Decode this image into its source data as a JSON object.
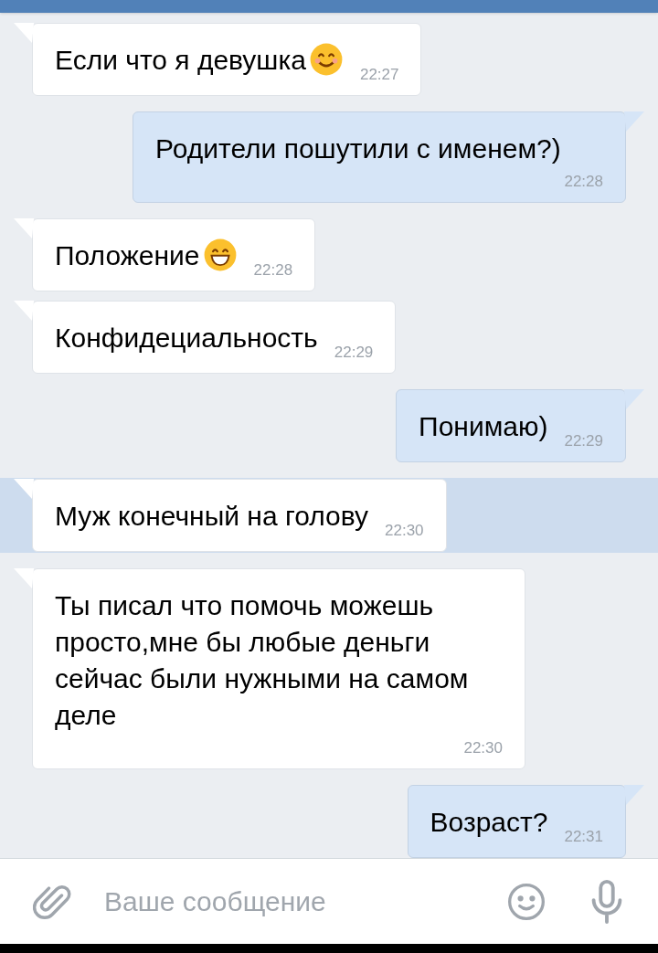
{
  "messages": [
    {
      "kind": "incoming",
      "text": "Если что я девушка",
      "emoji": {
        "kind": "smiling"
      },
      "time": "22:27",
      "selected": false
    },
    {
      "kind": "outgoing",
      "text": "Родители пошутили с именем?)",
      "time": "22:28",
      "selected": false
    },
    {
      "kind": "incoming",
      "text": "Положение",
      "emoji": {
        "kind": "grinning"
      },
      "time": "22:28",
      "selected": false
    },
    {
      "kind": "incoming",
      "text": "Конфидециальность",
      "time": "22:29",
      "selected": false
    },
    {
      "kind": "outgoing",
      "text": "Понимаю)",
      "time": "22:29",
      "selected": false
    },
    {
      "kind": "incoming",
      "text": "Муж конечный на голову",
      "time": "22:30",
      "selected": true
    },
    {
      "kind": "incoming",
      "text": "Ты писал что помочь можешь просто,мне бы любые деньги сейчас были нужными на самом деле",
      "time": "22:30",
      "selected": false
    },
    {
      "kind": "outgoing",
      "text": "Возраст?",
      "time": "22:31",
      "selected": false
    }
  ],
  "composer": {
    "placeholder": "Ваше сообщение"
  }
}
